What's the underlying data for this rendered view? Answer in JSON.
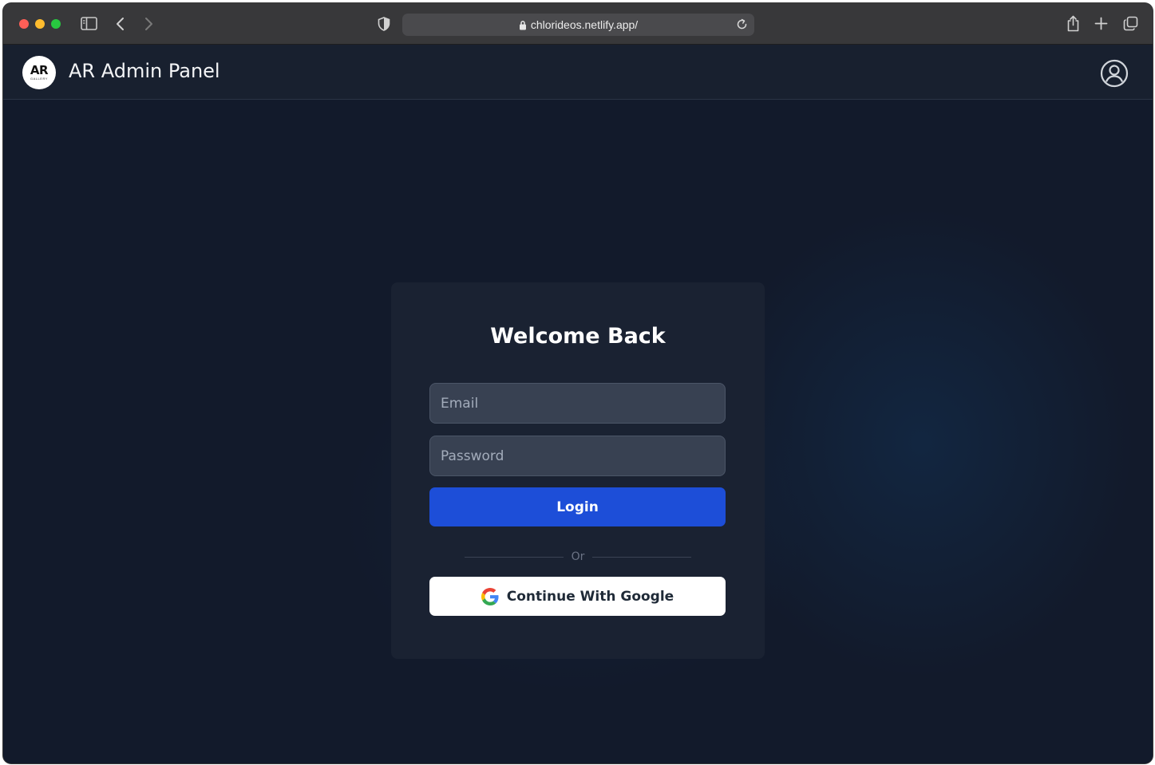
{
  "browser": {
    "url": "chlorideos.netlify.app/",
    "icons": [
      "sidebar-icon",
      "back-icon",
      "forward-icon",
      "shield-icon",
      "lock-icon",
      "reload-icon",
      "share-icon",
      "new-tab-icon",
      "tabs-overview-icon"
    ]
  },
  "header": {
    "logo_text": "AR",
    "logo_subtext": "GALLERY",
    "title": "AR Admin Panel",
    "profile_icon": "user-circle-icon"
  },
  "login": {
    "title": "Welcome Back",
    "email_placeholder": "Email",
    "password_placeholder": "Password",
    "login_label": "Login",
    "divider_text": "Or",
    "google_label": "Continue With Google"
  },
  "colors": {
    "background": "#121a2b",
    "card": "#1a2232",
    "input": "#384152",
    "primary": "#1d4ed8"
  }
}
